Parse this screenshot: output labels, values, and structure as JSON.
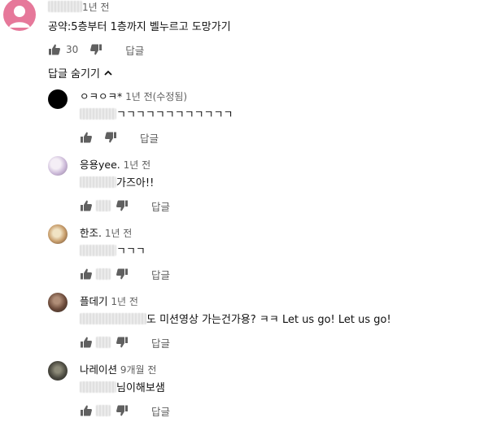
{
  "top_comment": {
    "time": "1년 전",
    "text": "공약:5층부터 1층까지 벨누르고 도망가기",
    "like_count": "30",
    "reply_label": "답글"
  },
  "hide_replies_label": "답글 숨기기",
  "replies": [
    {
      "author": "ㅇㅋㅇㅋ*",
      "time": "1년 전(수정됨)",
      "text": "ㄱㄱㄱㄱㄱㄱㄱㄱㄱㄱㄱㄱ",
      "reply_label": "답글"
    },
    {
      "author": "응용yee.",
      "time": "1년 전",
      "text": "가즈아!!",
      "reply_label": "답글"
    },
    {
      "author": "한조.",
      "time": "1년 전",
      "text": "ㄱㄱㄱ",
      "reply_label": "답글"
    },
    {
      "author": "플데기",
      "time": "1년 전",
      "text": "도 미션영상 가는건가용? ㅋㅋ Let us go! Let us go!",
      "reply_label": "답글"
    },
    {
      "author": "나레이션",
      "time": "9개월 전",
      "text": "님이해보샘",
      "reply_label": "답글"
    }
  ],
  "colors": {
    "text": "#0f0f0f",
    "secondary": "#606060",
    "avatar_pink": "#e6789a"
  }
}
